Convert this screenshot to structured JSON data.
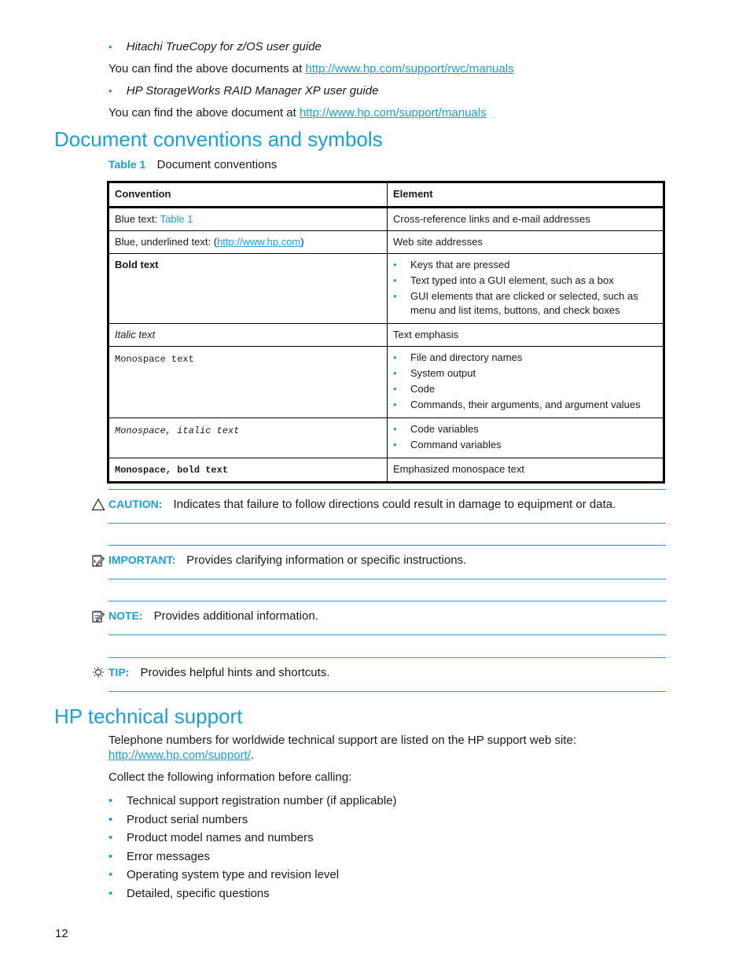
{
  "top": {
    "bullet1": "Hitachi TrueCopy for z/OS user guide",
    "line1_prefix": "You can find the above documents at ",
    "line1_link": "http://www.hp.com/support/rwc/manuals",
    "bullet2": "HP StorageWorks RAID Manager XP user guide",
    "line2_prefix": "You can find the above document at ",
    "line2_link": "http://www.hp.com/support/manuals"
  },
  "conventions": {
    "heading": "Document conventions and symbols",
    "table_caption_label": "Table 1",
    "table_caption_text": "Document conventions",
    "columns": [
      "Convention",
      "Element"
    ],
    "rows": [
      {
        "convention_prefix": "Blue text: ",
        "convention_link": "Table 1",
        "element": "Cross-reference links and e-mail addresses"
      },
      {
        "convention_prefix": "Blue, underlined text: (",
        "convention_link": "http://www.hp.com",
        "convention_suffix": ")",
        "element": "Web site addresses"
      },
      {
        "convention": "Bold text",
        "element_items": [
          "Keys that are pressed",
          "Text typed into a GUI element, such as a box",
          "GUI elements that are clicked or selected, such as menu and list items, buttons, and check boxes"
        ]
      },
      {
        "convention": "Italic text",
        "element": "Text emphasis"
      },
      {
        "convention": "Monospace text",
        "element_items": [
          "File and directory names",
          "System output",
          "Code",
          "Commands, their arguments, and argument values"
        ]
      },
      {
        "convention": "Monospace, italic text",
        "element_items": [
          "Code variables",
          "Command variables"
        ]
      },
      {
        "convention": "Monospace, bold text",
        "element": "Emphasized monospace text"
      }
    ]
  },
  "notices": [
    {
      "icon": "caution-triangle-icon",
      "label": "CAUTION:",
      "text": "Indicates that failure to follow directions could result in damage to equipment or data."
    },
    {
      "icon": "important-note-icon",
      "label": "IMPORTANT:",
      "text": "Provides clarifying information or specific instructions."
    },
    {
      "icon": "note-icon",
      "label": "NOTE:",
      "text": "Provides additional information."
    },
    {
      "icon": "tip-lightbulb-icon",
      "label": "TIP:",
      "text": "Provides helpful hints and shortcuts."
    }
  ],
  "support": {
    "heading": "HP technical support",
    "intro": "Telephone numbers for worldwide technical support are listed on the HP support web site:",
    "link": "http://www.hp.com/support/",
    "link_suffix": ".",
    "collect": "Collect the following information before calling:",
    "items": [
      "Technical support registration number (if applicable)",
      "Product serial numbers",
      "Product model names and numbers",
      "Error messages",
      "Operating system type and revision level",
      "Detailed, specific questions"
    ]
  },
  "page_number": "12",
  "colors": {
    "accent": "#1a9fd9",
    "text": "#1a1a1a"
  }
}
